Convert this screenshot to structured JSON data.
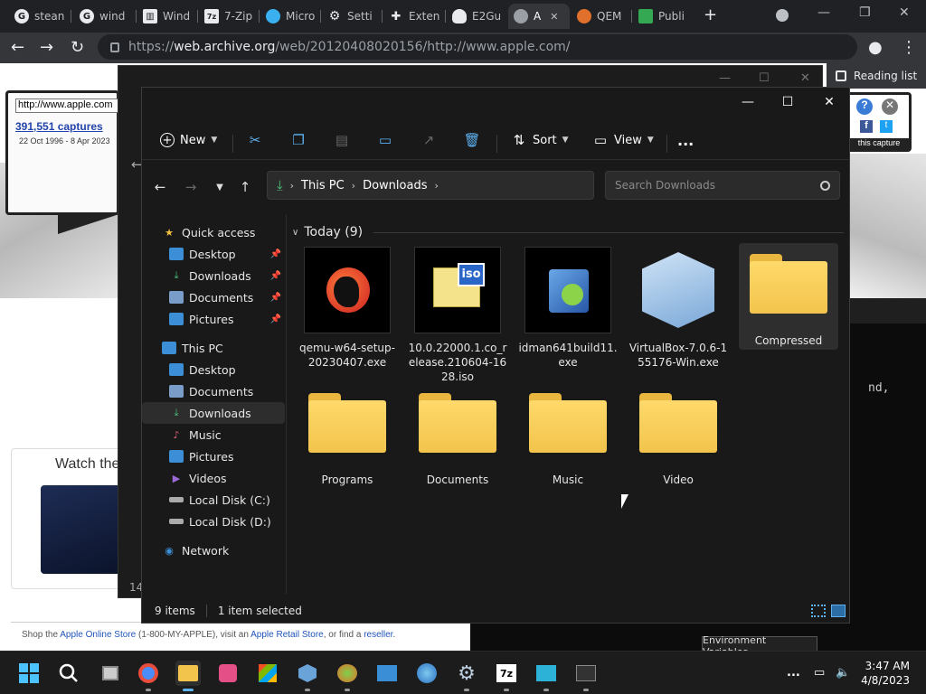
{
  "browser": {
    "tabs": [
      {
        "label": "stean",
        "icon": "google-icon",
        "color": "#ffffff"
      },
      {
        "label": "wind",
        "icon": "google-icon",
        "color": "#ffffff"
      },
      {
        "label": "Wind",
        "icon": "book-icon",
        "color": "#e8eaed"
      },
      {
        "label": "7-Zip",
        "icon": "7zip-icon",
        "color": "#e8eaed"
      },
      {
        "label": "Micro",
        "icon": "edge-icon",
        "color": "#3ab0f0"
      },
      {
        "label": "Setti",
        "icon": "gear-icon",
        "color": "#e8eaed"
      },
      {
        "label": "Exten",
        "icon": "puzzle-icon",
        "color": "#e8eaed"
      },
      {
        "label": "E2Gu",
        "icon": "cloud-icon",
        "color": "#e8eaed"
      },
      {
        "label": "A",
        "icon": "globe-icon",
        "color": "#e8eaed"
      },
      {
        "label": "QEM",
        "icon": "qemu-icon",
        "color": "#e0702c"
      },
      {
        "label": "Publi",
        "icon": "sheet-icon",
        "color": "#34a853"
      }
    ],
    "url_host": "web.archive.org",
    "url_path": "/web/20120408020156/http://www.apple.com/",
    "reading_list": "Reading list"
  },
  "webpage": {
    "wayback_url": "http://www.apple.com",
    "captures": "391,551 captures",
    "date_range": "22 Oct 1996 - 8 Apr 2023",
    "this_capture": "this capture",
    "watch_title": "Watch the",
    "footer_1": "Shop the ",
    "footer_link_store": "Apple Online Store",
    "footer_2": " (1-800-MY-APPLE), visit an ",
    "footer_link_retail": "Apple Retail Store",
    "footer_3": ", or find a ",
    "footer_link_reseller": "reseller",
    "footer_4": "."
  },
  "terminal": {
    "text": "nd,",
    "env_button": "Environment Variables..."
  },
  "ghost": {
    "num": "14"
  },
  "explorer": {
    "commands": {
      "new": "New",
      "sort": "Sort",
      "view": "View",
      "more": "..."
    },
    "address": {
      "this_pc": "This PC",
      "downloads": "Downloads"
    },
    "search_placeholder": "Search Downloads",
    "sidebar": [
      {
        "label": "Quick access",
        "icon": "star-icon",
        "color": "#f5c242"
      },
      {
        "label": "Desktop",
        "icon": "desktop-icon",
        "color": "#3c8fd6",
        "pinned": true
      },
      {
        "label": "Downloads",
        "icon": "download-icon",
        "color": "#4cc07a",
        "pinned": true
      },
      {
        "label": "Documents",
        "icon": "document-icon",
        "color": "#7a9cc8",
        "pinned": true
      },
      {
        "label": "Pictures",
        "icon": "picture-icon",
        "color": "#3c8fd6",
        "pinned": true
      },
      {
        "label": "This PC",
        "icon": "computer-icon",
        "color": "#3c8fd6"
      },
      {
        "label": "Desktop",
        "icon": "desktop-icon",
        "color": "#3c8fd6"
      },
      {
        "label": "Documents",
        "icon": "document-icon",
        "color": "#7a9cc8"
      },
      {
        "label": "Downloads",
        "icon": "download-icon",
        "color": "#4cc07a",
        "selected": true
      },
      {
        "label": "Music",
        "icon": "music-icon",
        "color": "#e0607a"
      },
      {
        "label": "Pictures",
        "icon": "picture-icon",
        "color": "#3c8fd6"
      },
      {
        "label": "Videos",
        "icon": "video-icon",
        "color": "#9a6ad6"
      },
      {
        "label": "Local Disk (C:)",
        "icon": "drive-icon",
        "color": "#aaaaaa"
      },
      {
        "label": "Local Disk (D:)",
        "icon": "drive-icon",
        "color": "#aaaaaa"
      },
      {
        "label": "Network",
        "icon": "network-icon",
        "color": "#3c8fd6"
      }
    ],
    "group_header": "Today (9)",
    "files": [
      {
        "name": "qemu-w64-setup-20230407.exe",
        "kind": "qemu"
      },
      {
        "name": "10.0.22000.1.co_release.210604-1628.iso",
        "kind": "iso",
        "badge": "iso"
      },
      {
        "name": "idman641build11.exe",
        "kind": "idm"
      },
      {
        "name": "VirtualBox-7.0.6-155176-Win.exe",
        "kind": "vbox"
      },
      {
        "name": "Compressed",
        "kind": "folder",
        "selected": true
      },
      {
        "name": "Programs",
        "kind": "folder"
      },
      {
        "name": "Documents",
        "kind": "folder"
      },
      {
        "name": "Music",
        "kind": "folder"
      },
      {
        "name": "Video",
        "kind": "folder"
      }
    ],
    "status_items": "9 items",
    "status_selected": "1 item selected"
  },
  "taskbar": {
    "time": "3:47 AM",
    "date": "4/8/2023",
    "more": "..."
  }
}
